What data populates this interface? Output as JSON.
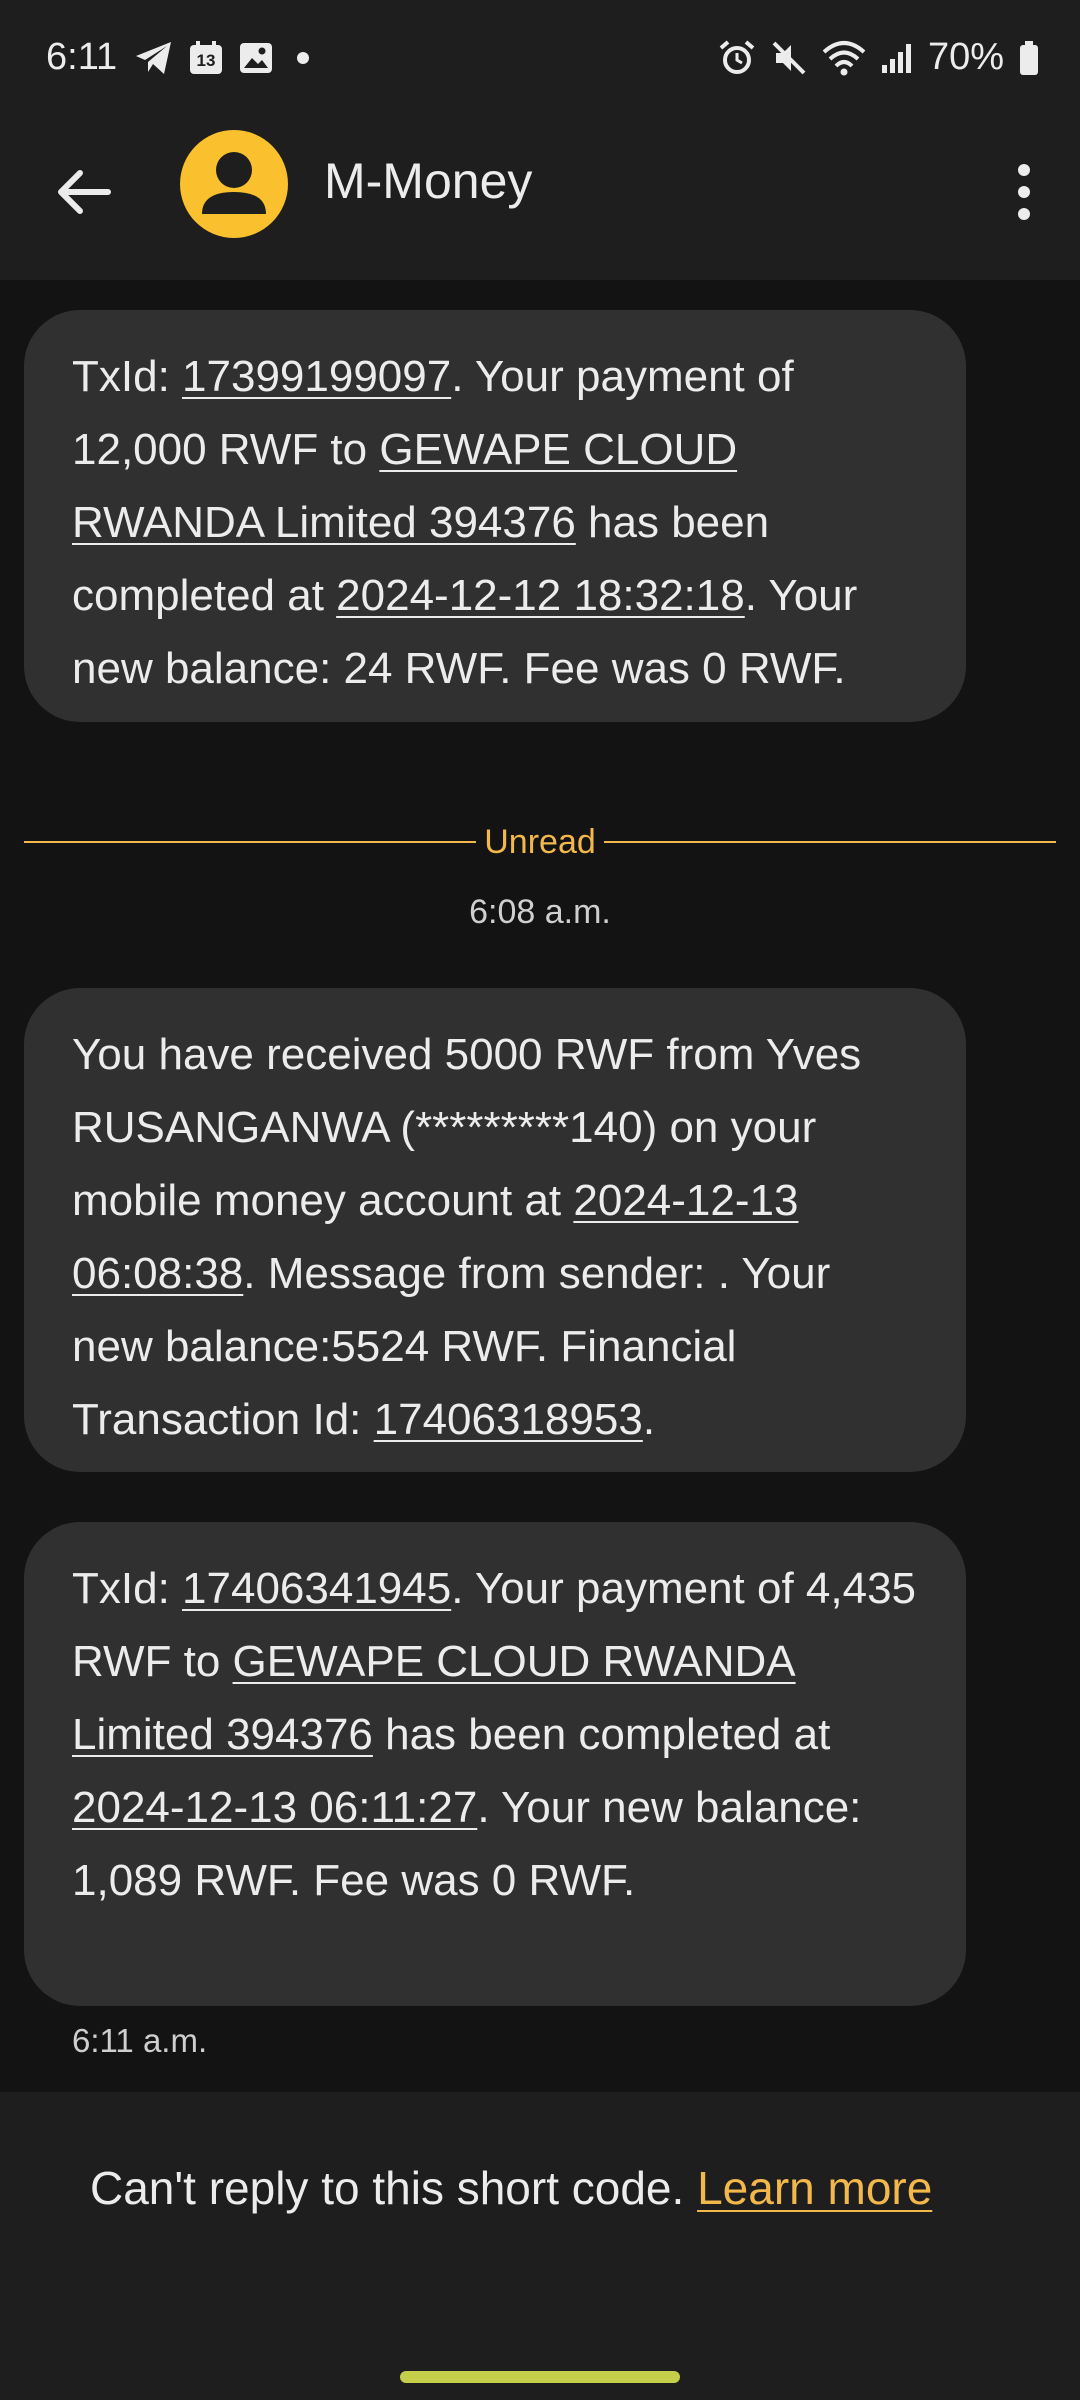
{
  "status_bar": {
    "time": "6:11",
    "notification_icons": [
      "telegram-icon",
      "calendar-icon",
      "gallery-icon",
      "dot-icon"
    ],
    "calendar_day": "13",
    "system_icons": [
      "alarm-icon",
      "mute-icon",
      "wifi-icon",
      "signal-icon",
      "battery-icon"
    ],
    "battery": "70%"
  },
  "app_bar": {
    "contact_name": "M-Money",
    "avatar_color": "#fbc02d"
  },
  "messages": [
    {
      "parts": [
        {
          "t": "TxId: "
        },
        {
          "t": "17399199097",
          "u": true
        },
        {
          "t": ". Your payment of 12,000 RWF to "
        },
        {
          "t": "GEWAPE CLOUD RWANDA Limited 394376",
          "u": true
        },
        {
          "t": " has been completed at "
        },
        {
          "t": "2024-12-12 18:32:18",
          "u": true
        },
        {
          "t": ". Your new balance: 24 RWF. Fee was 0 RWF."
        }
      ]
    },
    {
      "parts": [
        {
          "t": "You have received 5000 RWF from Yves RUSANGANWA (*********140) on your mobile money account at "
        },
        {
          "t": "2024-12-13 06:08:38",
          "u": true
        },
        {
          "t": ". Message from sender: . Your new balance:5524 RWF. Financial Transaction Id: "
        },
        {
          "t": "17406318953",
          "u": true
        },
        {
          "t": "."
        }
      ]
    },
    {
      "parts": [
        {
          "t": "TxId: "
        },
        {
          "t": "17406341945",
          "u": true
        },
        {
          "t": ". Your payment of 4,435 RWF to "
        },
        {
          "t": "GEWAPE CLOUD RWANDA Limited 394376",
          "u": true
        },
        {
          "t": " has been completed at "
        },
        {
          "t": "2024-12-13 06:11:27",
          "u": true
        },
        {
          "t": ". Your new balance: 1,089 RWF. Fee was 0 RWF."
        }
      ]
    }
  ],
  "divider": {
    "label": "Unread",
    "color": "#f2b84b"
  },
  "timestamps": {
    "unread_time": "6:08 a.m.",
    "last_time": "6:11 a.m."
  },
  "footer": {
    "text": "Can't reply to this short code. ",
    "link": "Learn more",
    "link_color": "#f2b84b"
  },
  "colors": {
    "background": "#131313",
    "bubble": "#303030",
    "nav_handle": "#c6cf4a"
  }
}
